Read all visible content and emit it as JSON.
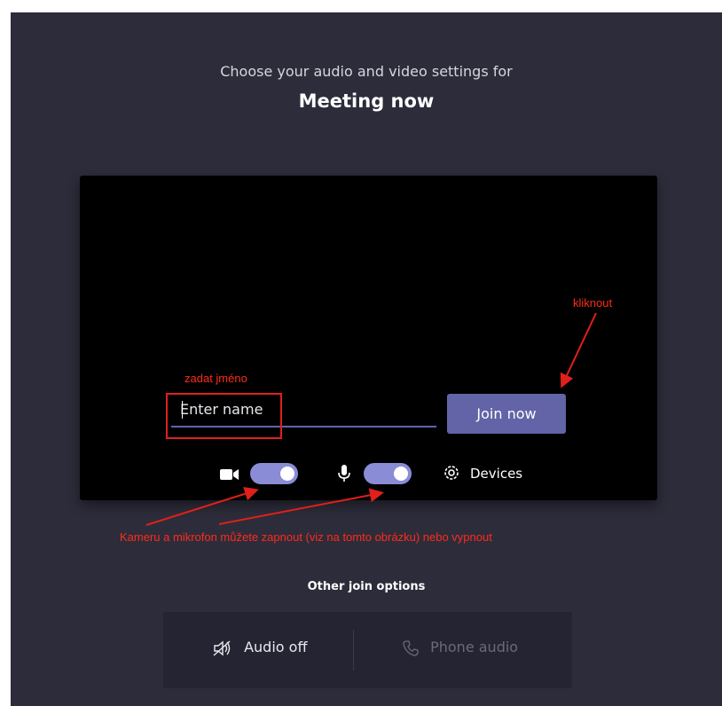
{
  "header": {
    "subtitle": "Choose your audio and video settings for",
    "meeting_title": "Meeting now"
  },
  "prejoin": {
    "name_input": {
      "placeholder": "Enter name",
      "value": ""
    },
    "join_button_label": "Join now",
    "camera_toggle": {
      "on": true
    },
    "mic_toggle": {
      "on": true
    },
    "devices_label": "Devices"
  },
  "other_options": {
    "heading": "Other join options",
    "audio_off_label": "Audio off",
    "phone_audio_label": "Phone audio"
  },
  "annotations": {
    "click_label": "kliknout",
    "enter_name_label": "zadat jméno",
    "toggles_note": "Kameru a mikrofon můžete zapnout (viz na tomto obrázku) nebo vypnout"
  },
  "colors": {
    "background": "#2d2c3a",
    "preview": "#000000",
    "accent": "#6264a7",
    "toggle_on": "#8a8cd6",
    "annotation": "#ff2b1a"
  },
  "icons": [
    "video-camera-icon",
    "microphone-icon",
    "gear-icon",
    "speaker-off-icon",
    "phone-icon"
  ]
}
